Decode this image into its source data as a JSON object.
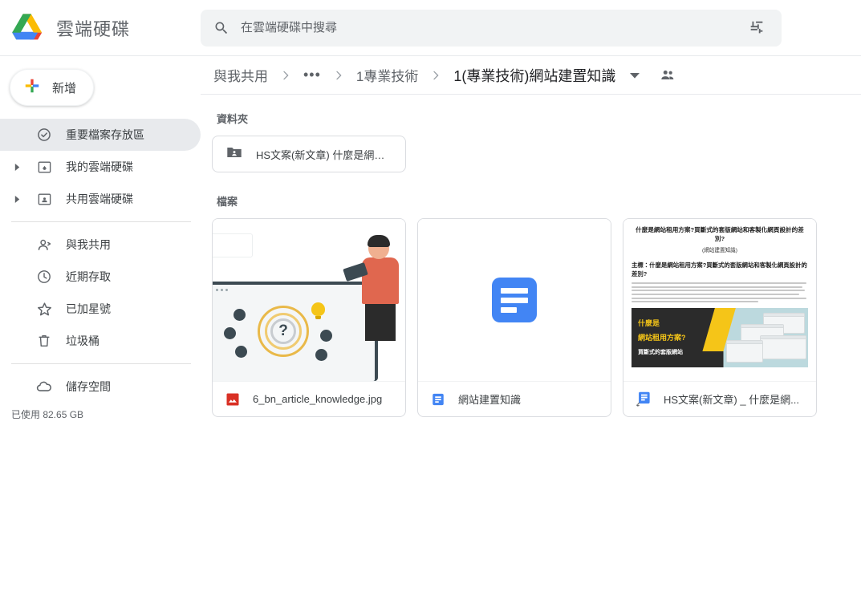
{
  "app": {
    "brand_title": "雲端硬碟",
    "logo_icon": "google-drive-logo"
  },
  "search": {
    "placeholder": "在雲端硬碟中搜尋",
    "value": "",
    "search_icon": "search-icon",
    "options_icon": "tune-options-icon"
  },
  "sidebar": {
    "new_button": {
      "label": "新增",
      "icon": "plus-icon"
    },
    "items": [
      {
        "label": "重要檔案存放區",
        "icon": "check-circle-icon",
        "active": true,
        "expandable": false
      },
      {
        "label": "我的雲端硬碟",
        "icon": "my-drive-icon",
        "active": false,
        "expandable": true
      },
      {
        "label": "共用雲端硬碟",
        "icon": "shared-drive-icon",
        "active": false,
        "expandable": true
      },
      {
        "label": "與我共用",
        "icon": "people-icon",
        "active": false,
        "expandable": false
      },
      {
        "label": "近期存取",
        "icon": "clock-icon",
        "active": false,
        "expandable": false
      },
      {
        "label": "已加星號",
        "icon": "star-icon",
        "active": false,
        "expandable": false
      },
      {
        "label": "垃圾桶",
        "icon": "trash-icon",
        "active": false,
        "expandable": false
      },
      {
        "label": "儲存空間",
        "icon": "cloud-icon",
        "active": false,
        "expandable": false
      }
    ],
    "storage_used": "已使用 82.65 GB"
  },
  "breadcrumb": {
    "root": "與我共用",
    "overflow": "•••",
    "parent": "1專業技術",
    "current": "1(專業技術)網站建置知識",
    "caret_icon": "chevron-down-icon",
    "shared_icon": "people-shared-icon",
    "separator_icon": "chevron-right-icon"
  },
  "main": {
    "folders_title": "資料夾",
    "files_title": "檔案",
    "folders": [
      {
        "name": "HS文案(新文章) 什麼是網站...",
        "icon": "shared-folder-icon"
      }
    ],
    "files": [
      {
        "name": "6_bn_article_knowledge.jpg",
        "icon": "image-file-icon",
        "thumb_type": "illustration",
        "thumb_alt": "插圖：男子持筆電，螢幕顯示迷宮問號與燈泡"
      },
      {
        "name": "網站建置知識",
        "icon": "google-docs-icon",
        "thumb_type": "docs-icon",
        "thumb_alt": "Google 文件"
      },
      {
        "name": "HS文案(新文章) _ 什麼是網...",
        "icon": "google-docs-shortcut-icon",
        "thumb_type": "document-preview",
        "preview": {
          "title": "什麼是網站租用方案?買斷式的套版網站和客製化網頁設計的差別?",
          "subtitle": "(網站建置知識)",
          "heading": "主標：什麼是網站租用方案?買斷式的套版網站和客製化網頁設計的差別?",
          "banner_line1": "什麼是",
          "banner_line2": "網站租用方案?",
          "banner_line3": "買斷式的套版網站"
        }
      }
    ]
  },
  "colors": {
    "drive_blue": "#4285f4",
    "drive_green": "#34a853",
    "drive_yellow": "#fbbc04",
    "drive_red": "#ea4335",
    "image_red": "#d93025",
    "text_primary": "#202124",
    "text_secondary": "#5f6368",
    "surface_gray": "#f1f3f4",
    "active_gray": "#e8eaed",
    "border_gray": "#dadce0"
  }
}
